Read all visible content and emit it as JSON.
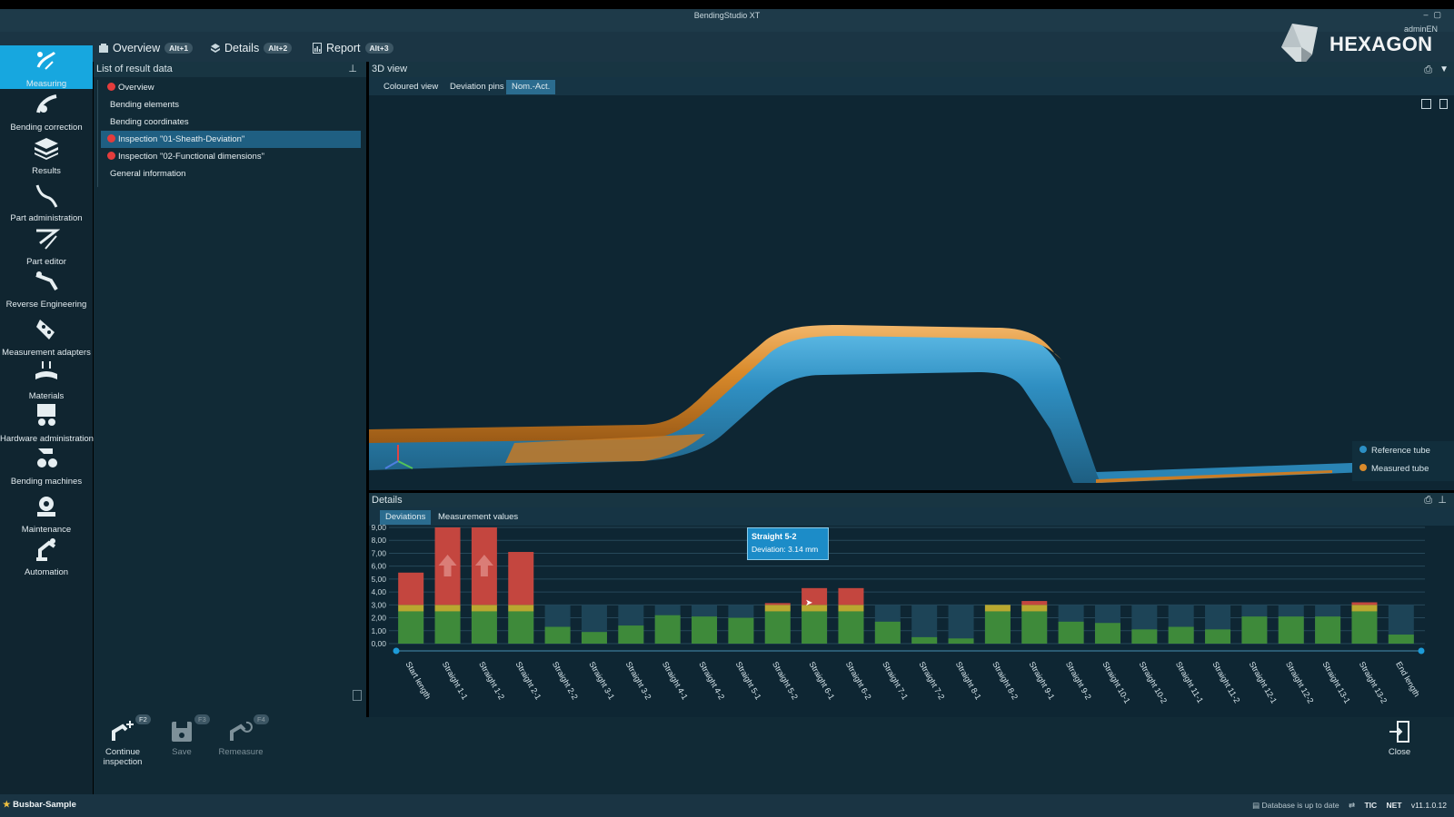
{
  "app": {
    "title": "BendingStudio XT",
    "user": "adminEN",
    "brand": "HEXAGON"
  },
  "tabs": [
    {
      "label": "Overview",
      "shortcut": "Alt+1"
    },
    {
      "label": "Details",
      "shortcut": "Alt+2"
    },
    {
      "label": "Report",
      "shortcut": "Alt+3"
    }
  ],
  "sidebar": {
    "items": [
      {
        "label": "Measuring",
        "icon": "measuring-icon",
        "active": true
      },
      {
        "label": "Bending correction",
        "icon": "bending-correction-icon"
      },
      {
        "label": "Results",
        "icon": "results-layers-icon"
      },
      {
        "label": "Part administration",
        "icon": "part-administration-icon"
      },
      {
        "label": "Part editor",
        "icon": "part-editor-icon"
      },
      {
        "label": "Reverse Engineering",
        "icon": "reverse-engineering-icon"
      },
      {
        "label": "Measurement adapters",
        "icon": "measurement-adapters-icon"
      },
      {
        "label": "Materials",
        "icon": "materials-icon"
      },
      {
        "label": "Hardware administration",
        "icon": "hardware-administration-icon"
      },
      {
        "label": "Bending machines",
        "icon": "bending-machines-icon"
      },
      {
        "label": "Maintenance",
        "icon": "maintenance-icon"
      },
      {
        "label": "Automation",
        "icon": "automation-icon"
      }
    ]
  },
  "result_list": {
    "title": "List of result data",
    "items": [
      {
        "label": "Overview",
        "status": "error"
      },
      {
        "label": "Bending elements",
        "status": "none"
      },
      {
        "label": "Bending coordinates",
        "status": "none"
      },
      {
        "label": "Inspection \"01-Sheath-Deviation\"",
        "status": "error",
        "selected": true
      },
      {
        "label": "Inspection \"02-Functional dimensions\"",
        "status": "error"
      },
      {
        "label": "General information",
        "status": "none"
      }
    ]
  },
  "view3d": {
    "title": "3D view",
    "tabs": [
      "Coloured view",
      "Deviation pins",
      "Nom.-Act."
    ],
    "active_tab": "Nom.-Act.",
    "legend": [
      {
        "label": "Reference tube",
        "color": "#2c8fc4"
      },
      {
        "label": "Measured tube",
        "color": "#d98a2b"
      }
    ]
  },
  "details": {
    "title": "Details",
    "tabs": [
      "Deviations",
      "Measurement values"
    ],
    "active_tab": "Deviations",
    "tooltip": {
      "title": "Straight 5-2",
      "text": "Deviation: 3.14 mm"
    }
  },
  "chart_data": {
    "type": "bar",
    "categories": [
      "Start length",
      "Straight 1-1",
      "Straight 1-2",
      "Straight 2-1",
      "Straight 2-2",
      "Straight 3-1",
      "Straight 3-2",
      "Straight 4-1",
      "Straight 4-2",
      "Straight 5-1",
      "Straight 5-2",
      "Straight 6-1",
      "Straight 6-2",
      "Straight 7-1",
      "Straight 7-2",
      "Straight 8-1",
      "Straight 8-2",
      "Straight 9-1",
      "Straight 9-2",
      "Straight 10-1",
      "Straight 10-2",
      "Straight 11-1",
      "Straight 11-2",
      "Straight 12-1",
      "Straight 12-2",
      "Straight 13-1",
      "Straight 13-2",
      "End length"
    ],
    "values": [
      5.5,
      9.0,
      9.0,
      7.1,
      1.3,
      0.9,
      1.4,
      2.2,
      2.1,
      2.0,
      3.14,
      4.3,
      4.3,
      1.7,
      0.5,
      0.4,
      3.0,
      3.3,
      1.7,
      1.6,
      1.1,
      1.3,
      1.1,
      2.1,
      2.1,
      2.1,
      3.2,
      0.7
    ],
    "exceeds_range": [
      false,
      true,
      true,
      false,
      false,
      false,
      false,
      false,
      false,
      false,
      false,
      false,
      false,
      false,
      false,
      false,
      false,
      false,
      false,
      false,
      false,
      false,
      false,
      false,
      false,
      false,
      false,
      false
    ],
    "yticks": [
      "9,00",
      "8,00",
      "7,00",
      "6,00",
      "5,00",
      "4,00",
      "3,00",
      "2,00",
      "1,00",
      "0,00"
    ],
    "ylim": [
      0,
      9
    ],
    "thresholds": {
      "ok": 2.5,
      "warning": 3.0
    },
    "colors": {
      "ok": "#3e8a3a",
      "warning": "#b9a830",
      "error": "#c4463f",
      "background_band": "#1d4457"
    },
    "grid": true
  },
  "actions": [
    {
      "label": "Continue inspection",
      "key": "F2",
      "icon": "continue-inspection-icon",
      "enabled": true
    },
    {
      "label": "Save",
      "key": "F3",
      "icon": "save-icon",
      "enabled": false
    },
    {
      "label": "Remeasure",
      "key": "F4",
      "icon": "remeasure-icon",
      "enabled": false
    },
    {
      "label": "Close",
      "icon": "close-exit-icon",
      "enabled": true
    }
  ],
  "status": {
    "project": "Busbar-Sample",
    "database": "Database is up to date",
    "tic": "TIC",
    "net": "NET",
    "version": "v11.1.0.12"
  }
}
